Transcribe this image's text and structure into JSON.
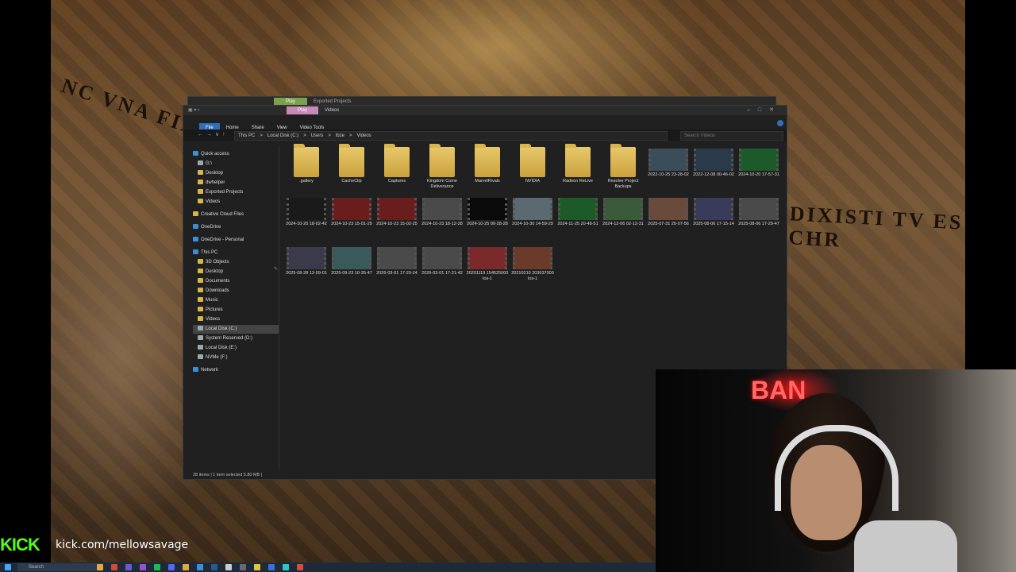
{
  "overlay": {
    "kick_logo": "KICK",
    "stream_url": "kick.com/mellowsavage",
    "webcam_sign": "BAN"
  },
  "back_window": {
    "tab_label": "Play",
    "title": "Exported Projects"
  },
  "window": {
    "play_tab": "Play",
    "title": "Videos",
    "ribbon": [
      "File",
      "Home",
      "Share",
      "View",
      "Video Tools"
    ],
    "breadcrumb": [
      "This PC",
      ">",
      "Local Disk (C:)",
      ">",
      "Users",
      ">",
      "ibze",
      ">",
      "Videos"
    ],
    "search_placeholder": "Search Videos",
    "status": "28 items  |  1 item selected  5.80 MB  |"
  },
  "nav": [
    {
      "label": "Quick access",
      "icon": "star-icon",
      "sel": false
    },
    {
      "label": "G:\\",
      "icon": "drive-icon",
      "sel": false
    },
    {
      "label": "Desktop",
      "icon": "folder-icon",
      "sel": false
    },
    {
      "label": "dwhelper",
      "icon": "folder-icon",
      "sel": false
    },
    {
      "label": "Exported Projects",
      "icon": "folder-icon",
      "sel": false
    },
    {
      "label": "Videos",
      "icon": "folder-icon",
      "sel": false
    },
    {
      "label": "Creative Cloud Files",
      "icon": "folder-icon",
      "sel": false
    },
    {
      "label": "OneDrive",
      "icon": "cloud-icon",
      "sel": false
    },
    {
      "label": "OneDrive - Personal",
      "icon": "cloud-icon",
      "sel": false
    },
    {
      "label": "This PC",
      "icon": "pc-icon",
      "sel": false
    },
    {
      "label": "3D Objects",
      "icon": "folder-icon",
      "sel": false
    },
    {
      "label": "Desktop",
      "icon": "folder-icon",
      "sel": false
    },
    {
      "label": "Documents",
      "icon": "folder-icon",
      "sel": false
    },
    {
      "label": "Downloads",
      "icon": "folder-icon",
      "sel": false
    },
    {
      "label": "Music",
      "icon": "folder-icon",
      "sel": false
    },
    {
      "label": "Pictures",
      "icon": "folder-icon",
      "sel": false
    },
    {
      "label": "Videos",
      "icon": "folder-icon",
      "sel": false
    },
    {
      "label": "Local Disk (C:)",
      "icon": "drive-icon",
      "sel": true
    },
    {
      "label": "System Reserved (D:)",
      "icon": "drive-icon",
      "sel": false
    },
    {
      "label": "Local Disk (E:)",
      "icon": "drive-icon",
      "sel": false
    },
    {
      "label": "NVMe (F:)",
      "icon": "drive-icon",
      "sel": false
    },
    {
      "label": "Network",
      "icon": "network-icon",
      "sel": false
    }
  ],
  "items": [
    {
      "name": ".gallery",
      "kind": "folder"
    },
    {
      "name": "CacheClip",
      "kind": "folder"
    },
    {
      "name": "Captures",
      "kind": "folder"
    },
    {
      "name": "Kingdom Come Deliverance",
      "kind": "folder"
    },
    {
      "name": "MarvelRivals",
      "kind": "folder"
    },
    {
      "name": "NVIDIA",
      "kind": "folder"
    },
    {
      "name": "Radeon ReLive",
      "kind": "folder"
    },
    {
      "name": "Resolve Project Backups",
      "kind": "folder"
    },
    {
      "name": "2022-10-25 23-28-02",
      "kind": "video"
    },
    {
      "name": "2022-12-08 00-46-02",
      "kind": "video"
    },
    {
      "name": "2024-10-20 17-57-31",
      "kind": "video"
    },
    {
      "name": "2024-10-20 18-02-42",
      "kind": "video"
    },
    {
      "name": "2024-10-23 15-01-29",
      "kind": "video"
    },
    {
      "name": "2024-10-23 15-02-25",
      "kind": "video"
    },
    {
      "name": "2024-10-23 18-12-28",
      "kind": "video"
    },
    {
      "name": "2024-10-25 00-28-28",
      "kind": "video"
    },
    {
      "name": "2024-10-30 14-59-29",
      "kind": "video"
    },
    {
      "name": "2024-11-25 20-48-51",
      "kind": "video"
    },
    {
      "name": "2024-12-06 02-12-31",
      "kind": "video"
    },
    {
      "name": "2025-07-31 20-07-56",
      "kind": "video"
    },
    {
      "name": "2025-08-06 17-15-14",
      "kind": "video"
    },
    {
      "name": "2025-08-06 17-29-47",
      "kind": "video"
    },
    {
      "name": "2025-08-28 12-09-01",
      "kind": "video"
    },
    {
      "name": "2025-09-23 10-35-47",
      "kind": "video"
    },
    {
      "name": "2026-03-01 17-20-24",
      "kind": "video"
    },
    {
      "name": "2026-03-01 17-21-42",
      "kind": "video"
    },
    {
      "name": "20201119 154525000 Ios-1",
      "kind": "video"
    },
    {
      "name": "20210210 203037000 Ios-1",
      "kind": "video"
    }
  ],
  "taskbar": {
    "search_label": "Search"
  }
}
